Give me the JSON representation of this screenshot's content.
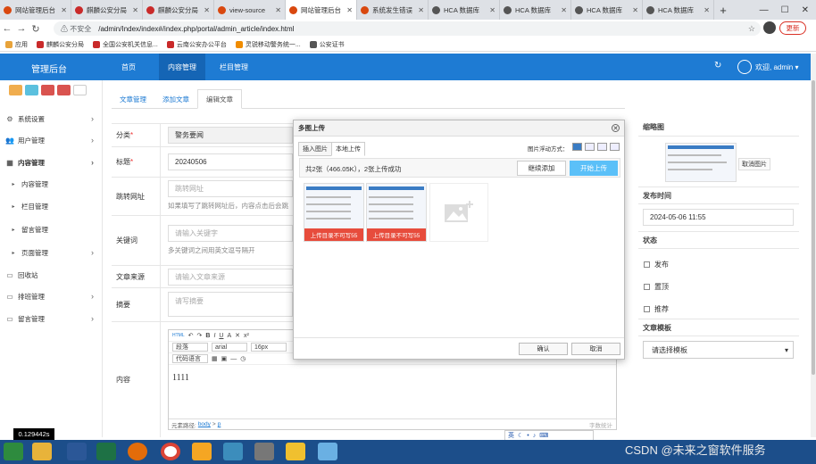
{
  "browser": {
    "tabs": [
      {
        "label": "网站管理后台",
        "color": "#d9480f"
      },
      {
        "label": "麒麟公安分局",
        "color": "#c92a2a"
      },
      {
        "label": "麒麟公安分局",
        "color": "#c92a2a"
      },
      {
        "label": "view-source",
        "color": "#d9480f"
      },
      {
        "label": "网站管理后台",
        "color": "#d9480f",
        "active": true
      },
      {
        "label": "系统发生错误",
        "color": "#d9480f"
      },
      {
        "label": "HCA 数据库",
        "color": "#555"
      },
      {
        "label": "HCA 数据库",
        "color": "#555"
      },
      {
        "label": "HCA 数据库",
        "color": "#555"
      },
      {
        "label": "HCA 数据库",
        "color": "#555"
      }
    ],
    "new_tab": "+",
    "not_secure": "不安全",
    "url": "/admin/Index/index#/index.php/portal/admin_article/index.html",
    "update_label": "更新",
    "bookmarks": [
      "应用",
      "麒麟公安分局",
      "全国公安机关信息...",
      "云南公安办公平台",
      "灵锐移动警务统一...",
      "公安证书"
    ]
  },
  "header": {
    "title": "管理后台",
    "nav": [
      "首页",
      "内容管理",
      "栏目管理"
    ],
    "welcome": "欢迎, admin ▾"
  },
  "sidebar": {
    "items": [
      {
        "label": "系统设置",
        "icon": "gear-icon",
        "arrow": true
      },
      {
        "label": "用户管理",
        "icon": "users-icon",
        "arrow": true
      },
      {
        "label": "内容管理",
        "icon": "grid-icon",
        "arrow": true,
        "active": true
      },
      {
        "label": "内容管理",
        "icon": "bullet-icon",
        "sub": true
      },
      {
        "label": "栏目管理",
        "icon": "bullet-icon",
        "sub": true
      },
      {
        "label": "留言管理",
        "icon": "bullet-icon",
        "sub": true
      },
      {
        "label": "页面管理",
        "icon": "bullet-icon",
        "sub": true,
        "arrow": true
      },
      {
        "label": "回收站",
        "icon": "monitor-icon"
      },
      {
        "label": "排班管理",
        "icon": "monitor-icon",
        "arrow": true
      },
      {
        "label": "留言管理",
        "icon": "monitor-icon",
        "arrow": true
      }
    ]
  },
  "page_tabs": [
    "文章管理",
    "添加文章",
    "编辑文章"
  ],
  "form": {
    "category_label": "分类",
    "category_value": "警务要闻",
    "title_label": "标题",
    "title_value": "20240506",
    "redirect_label": "跳转网址",
    "redirect_placeholder": "跳转网址",
    "redirect_hint": "如果填写了跳转网址后，内容点击后会跳",
    "keywords_label": "关键词",
    "keywords_placeholder": "请输入关键字",
    "keywords_hint": "多关键词之间用英文逗号隔开",
    "source_label": "文章来源",
    "source_placeholder": "请输入文章来源",
    "summary_label": "摘要",
    "summary_placeholder": "请写摘要",
    "content_label": "内容",
    "editor": {
      "paragraph": "段落",
      "font": "arial",
      "size": "16px",
      "codelang": "代码语言",
      "content": "1111",
      "path_label": "元素路径:",
      "path_body": "body",
      "path_p": "p",
      "wordcount": "字数统计"
    }
  },
  "right": {
    "thumb_label": "缩略图",
    "cancel_image": "取消图片",
    "publish_time_label": "发布时间",
    "publish_time": "2024-05-06 11:55",
    "status_label": "状态",
    "status": [
      "发布",
      "置顶",
      "推荐"
    ],
    "template_label": "文章模板",
    "template_placeholder": "请选择模板"
  },
  "dialog": {
    "title": "多图上传",
    "tabs": [
      "插入图片",
      "本地上传"
    ],
    "float_label": "图片浮动方式：",
    "count_text": "共2张（466.05K），2张上传成功",
    "continue_btn": "继续添加",
    "start_btn": "开始上传",
    "error_text": "上传目录不可写55",
    "ok_btn": "确认",
    "cancel_btn": "取消"
  },
  "taskbar": {
    "time_badge": "0.129442s",
    "watermark": "CSDN @未来之窗软件服务",
    "ime_label": "英"
  }
}
